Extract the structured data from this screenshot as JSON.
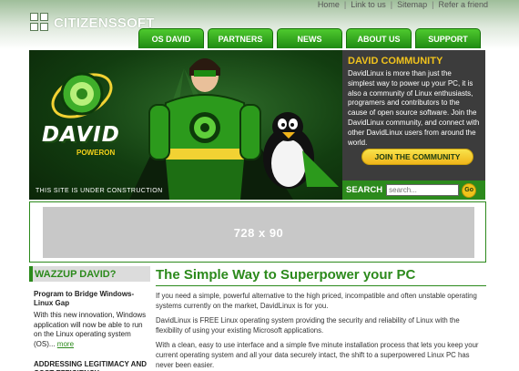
{
  "brand": {
    "name": "CITIZENSSOFT"
  },
  "top_links": [
    "Home",
    "Link to us",
    "Sitemap",
    "Refer a friend"
  ],
  "nav": [
    "OS DAVID",
    "PARTNERS",
    "NEWS",
    "ABOUT US",
    "SUPPORT"
  ],
  "hero": {
    "logo_text": "DAVID",
    "logo_sub": "POWERON",
    "construction": "THIS SITE IS UNDER CONSTRUCTION"
  },
  "community": {
    "title": "DAVID COMMUNITY",
    "text": "DavidLinux is more than just the simplest way to power up your PC, it is also a community of Linux enthusiasts, programers and contributors to the cause of open source software. Join the DavidLinux community, and connect with other DavidLinux users from around the world.",
    "button": "JOIN THE COMMUNITY"
  },
  "search": {
    "label": "SEARCH",
    "placeholder": "search...",
    "go": "Go"
  },
  "ad": {
    "text": "728 x 90"
  },
  "sidebar": {
    "title": "WAZZUP DAVID?",
    "item1_title": "Program to Bridge Windows-Linux Gap",
    "item1_text": "With this new innovation, Windows application will now be able to run on the Linux operating system (OS)...",
    "item1_more": "more",
    "item2_title": "ADDRESSING LEGITIMACY AND COST EFFICIENCY"
  },
  "main": {
    "title": "The Simple Way to Superpower your PC",
    "p1": "If you need a simple, powerful alternative to the high priced, incompatible and often unstable operating systems currently on the market, DavidLinux is for you.",
    "p2": "DavidLinux is FREE Linux operating system providing the security and reliability of Linux with the flexibility of using your existing Microsoft applications.",
    "p3": "With a clean, easy to use interface and a simple five minute installation process that lets you keep your current operating system and all your data securely intact, the shift to a superpowered Linux PC has never been easier."
  },
  "colors": {
    "green": "#2c8a1c",
    "yellow": "#f1c31c",
    "dark": "#3c3c3c"
  }
}
